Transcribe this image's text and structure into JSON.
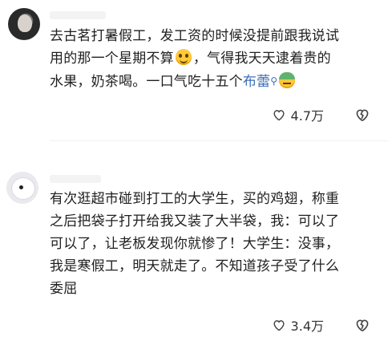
{
  "comments": [
    {
      "lines": [
        "去古茗打暑假工，发工资的时候没提前跟我说试",
        "用的那一个星期不算",
        "，气得我天天逮着贵的",
        "水果，奶茶喝。一口气吃十五个",
        "布蕾"
      ],
      "likes": "4.7万"
    },
    {
      "lines": [
        "有次逛超市碰到打工的大学生，买的鸡翅，称重",
        "之后把袋子打开给我又装了大半袋，我：可以了",
        "可以了，让老板发现你就惨了！大学生：没事，",
        "我是寒假工，明天就走了。不知道孩子受了什么",
        "委屈"
      ],
      "likes": "3.4万"
    }
  ],
  "colors": {
    "link": "#3d6fb6",
    "text": "#1f1f1f"
  },
  "icons": [
    "heart-outline-icon",
    "broken-heart-icon",
    "search-icon",
    "smile-emoji",
    "angry-emoji"
  ]
}
